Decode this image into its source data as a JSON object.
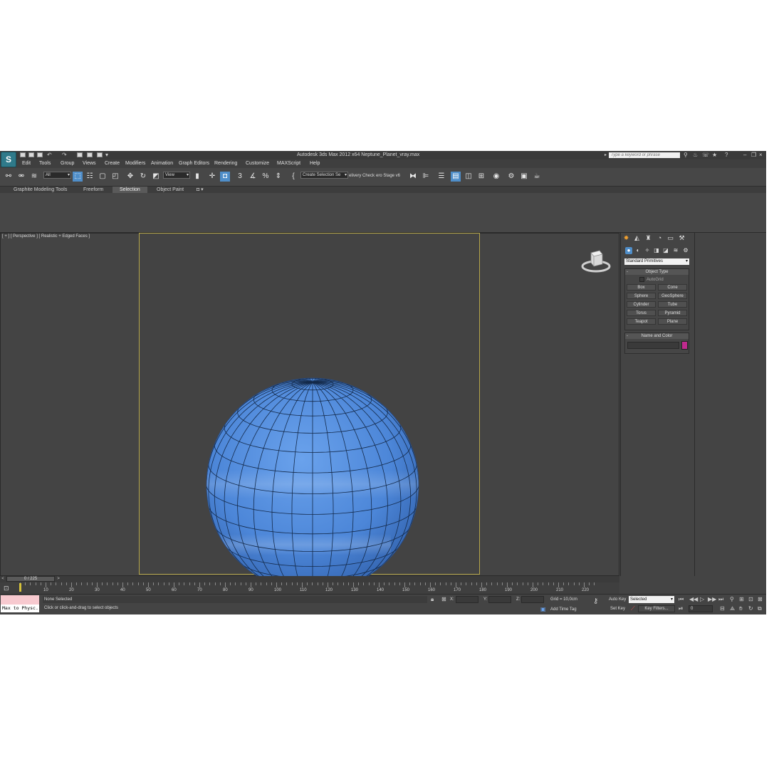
{
  "app": {
    "logo": "S",
    "title": "Autodesk 3ds Max  2012 x64     Neptune_Planet_vray.max",
    "search_placeholder": "Type a keyword or phrase"
  },
  "menu": [
    "Edit",
    "Tools",
    "Group",
    "Views",
    "Create",
    "Modifiers",
    "Animation",
    "Graph Editors",
    "Rendering",
    "Customize",
    "MAXScript",
    "Help"
  ],
  "toolbar": {
    "selection_filter": "All",
    "reference_coord": "View",
    "named_selection": "Create Selection Se",
    "delivery_check": "elivery Check",
    "hero_stage": "ero Stage v6"
  },
  "ribbon": {
    "tabs": [
      "Graphite Modeling Tools",
      "Freeform",
      "Selection",
      "Object Paint"
    ],
    "active_tab": "Selection"
  },
  "viewport": {
    "label": "[ + ] [ Perspective ] [ Realistic + Edged Faces ]",
    "sphere_color": "#4f86d8"
  },
  "command_panel": {
    "category": "Standard Primitives",
    "object_type_title": "Object Type",
    "autogrid": "AutoGrid",
    "buttons": [
      "Box",
      "Cone",
      "Sphere",
      "GeoSphere",
      "Cylinder",
      "Tube",
      "Torus",
      "Pyramid",
      "Teapot",
      "Plane"
    ],
    "name_color_title": "Name and Color",
    "object_color": "#c02a8e"
  },
  "timeline": {
    "frame_display": "0 / 225",
    "ticks": [
      "10",
      "20",
      "30",
      "40",
      "50",
      "60",
      "70",
      "80",
      "90",
      "100",
      "110",
      "120",
      "130",
      "140",
      "150",
      "160",
      "170",
      "180",
      "190",
      "200",
      "210",
      "220"
    ]
  },
  "status": {
    "maxscript_listener": "Max to Physc.",
    "selection_status": "None Selected",
    "prompt": "Click or click-and-drag to select objects",
    "x_label": "X:",
    "y_label": "Y:",
    "z_label": "Z:",
    "grid": "Grid = 10,0cm",
    "add_time_tag": "Add Time Tag",
    "auto_key": "Auto Key",
    "set_key": "Set Key",
    "key_mode": "Selected",
    "key_filters": "Key Filters...",
    "current_frame": "0"
  }
}
